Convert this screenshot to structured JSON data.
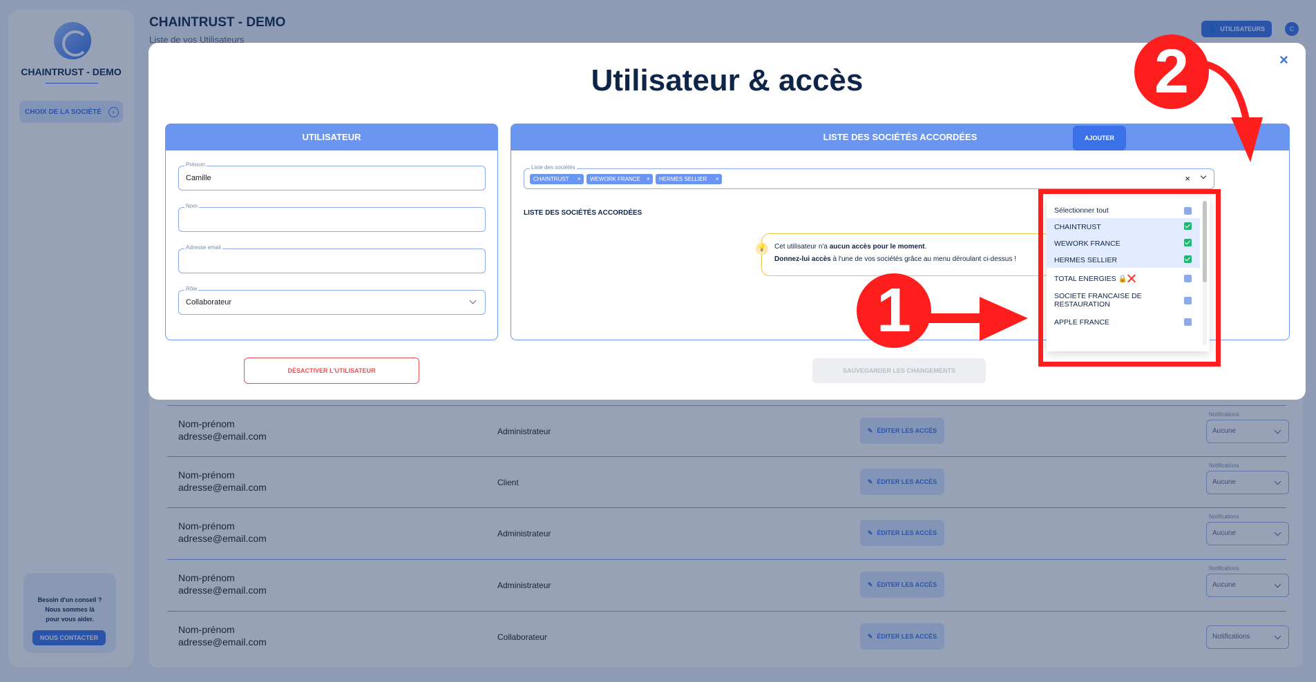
{
  "sidebar": {
    "brand": "CHAINTRUST - DEMO",
    "choice_label": "CHOIX DE LA SOCIÉTÉ",
    "help_lines": [
      "Besoin d'un conseil ?",
      "Nous sommes là",
      "pour vous aider."
    ],
    "contact_label": "NOUS CONTACTER"
  },
  "header": {
    "title": "CHAINTRUST - DEMO",
    "subtitle": "Liste de vos Utilisateurs",
    "users_button": "UTILISATEURS",
    "avatar_initial": "C"
  },
  "table": {
    "edit_label": "ÉDITER LES ACCÈS",
    "notif_label": "Notifications",
    "rows": [
      {
        "name": "Nom-prénom",
        "email": "adresse@email.com",
        "role": "Administrateur",
        "notif": "Aucune"
      },
      {
        "name": "Nom-prénom",
        "email": "adresse@email.com",
        "role": "Client",
        "notif": "Aucune"
      },
      {
        "name": "Nom-prénom",
        "email": "adresse@email.com",
        "role": "Administrateur",
        "notif": "Aucune"
      },
      {
        "name": "Nom-prénom",
        "email": "adresse@email.com",
        "role": "Administrateur",
        "notif": "Aucune"
      },
      {
        "name": "Nom-prénom",
        "email": "adresse@email.com",
        "role": "Collaborateur",
        "notif": "Notifications"
      }
    ]
  },
  "modal": {
    "title": "Utilisateur & accès",
    "close": "×",
    "user_panel": {
      "heading": "UTILISATEUR",
      "firstname_label": "Prénom",
      "firstname_value": "Camille",
      "lastname_label": "Nom",
      "email_label": "Adresse email",
      "role_label": "Rôle",
      "role_value": "Collaborateur"
    },
    "list_panel": {
      "heading": "LISTE DES SOCIÉTÉS ACCORDÉES",
      "select_label": "Liste des sociétés",
      "chips": [
        "CHAINTRUST",
        "WEWORK FRANCE",
        "HERMES SELLIER"
      ],
      "chip_remove": "×",
      "clear": "×",
      "add_button": "AJOUTER",
      "section_label": "LISTE DES SOCIÉTÉS ACCORDÉES",
      "info_line1_a": "Cet utilisateur n'a ",
      "info_line1_b": "aucun accès pour le moment",
      "info_line1_c": ".",
      "info_line2_a": "Donnez-lui accès",
      "info_line2_b": " à l'une de vos sociétés grâce au menu déroulant ci-dessus !"
    },
    "deactivate_button": "DÉSACTIVER L'UTILISATEUR",
    "save_button": "SAUVEGARDER LES CHANGEMENTS"
  },
  "dropdown": {
    "options": [
      {
        "label": "Sélectionner tout",
        "selected": false
      },
      {
        "label": "CHAINTRUST",
        "selected": true
      },
      {
        "label": "WEWORK FRANCE",
        "selected": true
      },
      {
        "label": "HERMES SELLIER",
        "selected": true
      },
      {
        "label": "TOTAL ENERGIES",
        "selected": false,
        "emoji": "🔒❌"
      },
      {
        "label": "SOCIETE FRANCAISE DE RESTAURATION",
        "selected": false
      },
      {
        "label": "APPLE FRANCE",
        "selected": false
      }
    ]
  },
  "annotations": {
    "step1": "1",
    "step2": "2",
    "highlight_color": "#ff1e1e"
  },
  "colors": {
    "primary": "#3a71e8",
    "panel_header": "#6a95f0",
    "danger": "#e85050",
    "check": "#22b573"
  }
}
